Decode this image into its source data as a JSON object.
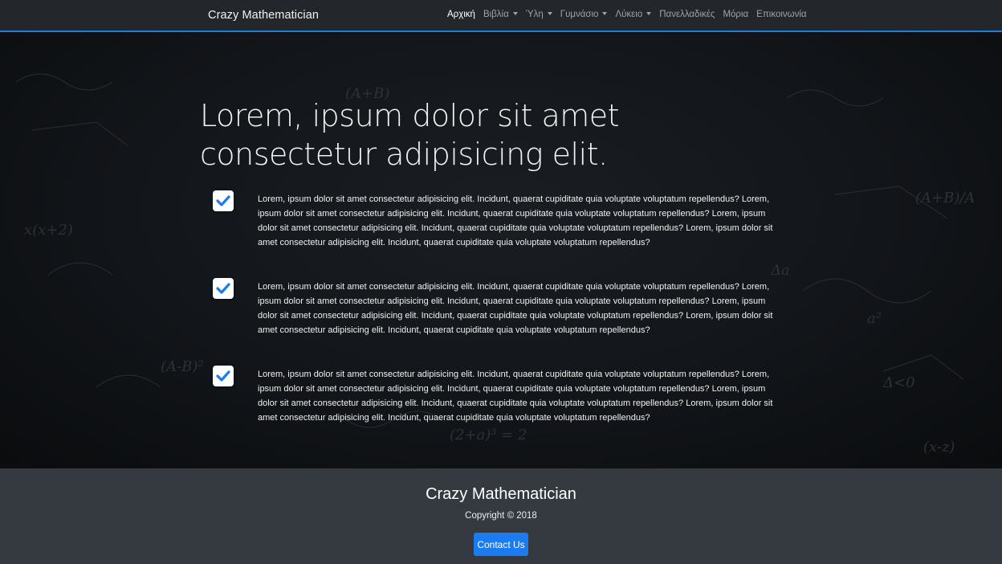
{
  "navbar": {
    "brand": "Crazy Mathematician",
    "items": [
      {
        "label": "Αρχική",
        "active": true,
        "dropdown": false
      },
      {
        "label": "Βιβλία",
        "active": false,
        "dropdown": true
      },
      {
        "label": "Ύλη",
        "active": false,
        "dropdown": true
      },
      {
        "label": "Γυμνάσιο",
        "active": false,
        "dropdown": true
      },
      {
        "label": "Λύκειο",
        "active": false,
        "dropdown": true
      },
      {
        "label": "Πανελλαδικές",
        "active": false,
        "dropdown": false
      },
      {
        "label": "Μόρια",
        "active": false,
        "dropdown": false
      },
      {
        "label": "Επικοινωνία",
        "active": false,
        "dropdown": false
      }
    ]
  },
  "hero": {
    "title": "Lorem, ipsum dolor sit amet consectetur adipisicing elit.",
    "features": [
      {
        "icon": "check-icon",
        "text": "Lorem, ipsum dolor sit amet consectetur adipisicing elit. Incidunt, quaerat cupiditate quia voluptate voluptatum repellendus? Lorem, ipsum dolor sit amet consectetur adipisicing elit. Incidunt, quaerat cupiditate quia voluptate voluptatum repellendus? Lorem, ipsum dolor sit amet consectetur adipisicing elit. Incidunt, quaerat cupiditate quia voluptate voluptatum repellendus? Lorem, ipsum dolor sit amet consectetur adipisicing elit. Incidunt, quaerat cupiditate quia voluptate voluptatum repellendus?"
      },
      {
        "icon": "check-icon",
        "text": "Lorem, ipsum dolor sit amet consectetur adipisicing elit. Incidunt, quaerat cupiditate quia voluptate voluptatum repellendus? Lorem, ipsum dolor sit amet consectetur adipisicing elit. Incidunt, quaerat cupiditate quia voluptate voluptatum repellendus? Lorem, ipsum dolor sit amet consectetur adipisicing elit. Incidunt, quaerat cupiditate quia voluptate voluptatum repellendus? Lorem, ipsum dolor sit amet consectetur adipisicing elit. Incidunt, quaerat cupiditate quia voluptate voluptatum repellendus?"
      },
      {
        "icon": "check-icon",
        "text": "Lorem, ipsum dolor sit amet consectetur adipisicing elit. Incidunt, quaerat cupiditate quia voluptate voluptatum repellendus? Lorem, ipsum dolor sit amet consectetur adipisicing elit. Incidunt, quaerat cupiditate quia voluptate voluptatum repellendus? Lorem, ipsum dolor sit amet consectetur adipisicing elit. Incidunt, quaerat cupiditate quia voluptate voluptatum repellendus? Lorem, ipsum dolor sit amet consectetur adipisicing elit. Incidunt, quaerat cupiditate quia voluptate voluptatum repellendus?"
      }
    ]
  },
  "footer": {
    "title": "Crazy Mathematician",
    "copyright": "Copyright © 2018",
    "contact_label": "Contact Us"
  },
  "colors": {
    "accent": "#1e7fd6",
    "button": "#1a7cf0",
    "navbar_bg": "#23272b",
    "footer_bg": "#343a40",
    "check": "#1a7cf0"
  }
}
